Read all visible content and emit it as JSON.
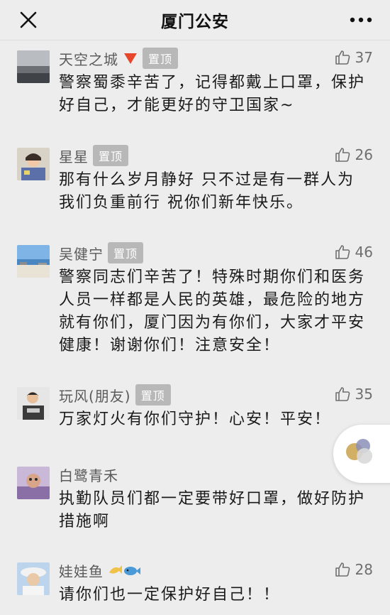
{
  "header": {
    "title": "厦门公安",
    "close_icon": "close-icon",
    "more_icon": "more-dots-icon"
  },
  "colors": {
    "background": "#ededed",
    "badge": "#b8b8b8",
    "name": "#5a5a5a",
    "text": "#1a1a1a"
  },
  "comments": [
    {
      "name": "天空之城",
      "emoji": "red-triangle-emoji",
      "badge": "置顶",
      "likes": "37",
      "text": "警察蜀黍辛苦了，记得都戴上口罩，保护好自己，才能更好的守卫国家~"
    },
    {
      "name": "星星",
      "badge": "置顶",
      "likes": "26",
      "text": "那有什么岁月静好  只不过是有一群人为我们负重前行   祝你们新年快乐。"
    },
    {
      "name": "吴健宁",
      "badge": "置顶",
      "likes": "46",
      "text": "警察同志们辛苦了！特殊时期你们和医务人员一样都是人民的英雄，最危险的地方就有你们，厦门因为有你们，大家才平安健康！谢谢你们！注意安全！"
    },
    {
      "name": "玩风(朋友)",
      "badge": "置顶",
      "likes": "35",
      "text": "万家灯火有你们守护！心安！平安！"
    },
    {
      "name": "白鹭青禾",
      "text": "执勤队员们都一定要带好口罩，做好防护措施啊"
    },
    {
      "name": "娃娃鱼",
      "emoji": "fish-emoji",
      "likes": "28",
      "text": "请你们也一定保护好自己！！"
    }
  ]
}
